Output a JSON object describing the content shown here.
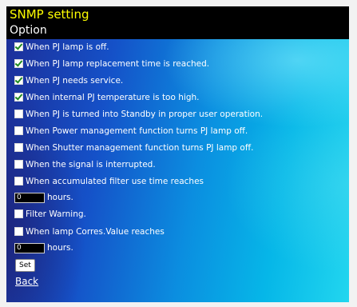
{
  "header": {
    "title": "SNMP setting",
    "subtitle": "Option",
    "title_color": "#ffff00"
  },
  "options": [
    {
      "label": "When PJ lamp is off.",
      "checked": true
    },
    {
      "label": "When PJ lamp replacement time is reached.",
      "checked": true
    },
    {
      "label": "When PJ needs service.",
      "checked": true
    },
    {
      "label": "When internal PJ temperature is too high.",
      "checked": true
    },
    {
      "label": "When PJ is turned into Standby in proper user operation.",
      "checked": false
    },
    {
      "label": "When Power management function turns PJ lamp off.",
      "checked": false
    },
    {
      "label": "When Shutter management function turns PJ lamp off.",
      "checked": false
    },
    {
      "label": "When the signal is interrupted.",
      "checked": false
    },
    {
      "label": "When accumulated filter use time reaches",
      "checked": false
    },
    {
      "label": "Filter Warning.",
      "checked": false
    },
    {
      "label": "When lamp Corres.Value reaches",
      "checked": false
    }
  ],
  "filter_hours": {
    "value": "0",
    "unit": "hours."
  },
  "lamp_hours": {
    "value": "0",
    "unit": "hours."
  },
  "set_button": "Set",
  "back_link": "Back"
}
